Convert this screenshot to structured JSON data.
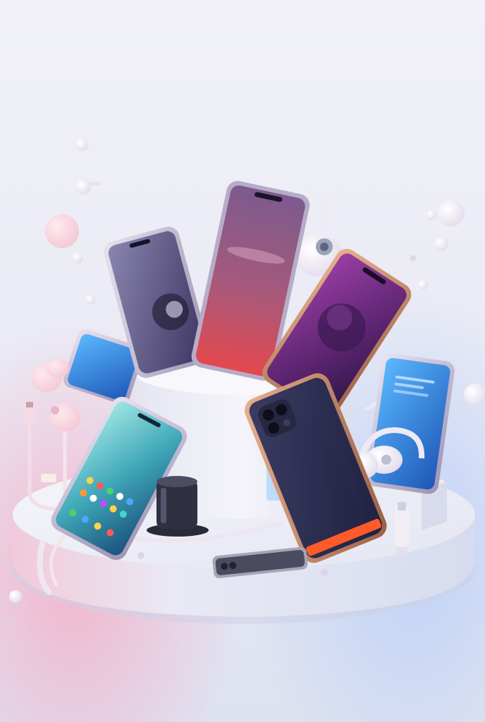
{
  "scene": {
    "subject": "smartphones-and-accessories-display",
    "colors": {
      "background_top": "#eeeef6",
      "background_bottom": "#dfe3f1",
      "platform": "#eceef7",
      "platform_shadow": "#cfd3e6",
      "accent_pink": "#ff6f8f",
      "accent_orange": "#ff5a2a",
      "phone_frame": "#c9c2d6",
      "screen_purple": "#6d3f86",
      "screen_blue": "#2e7ed6",
      "screen_teal": "#5fd1d6"
    }
  }
}
